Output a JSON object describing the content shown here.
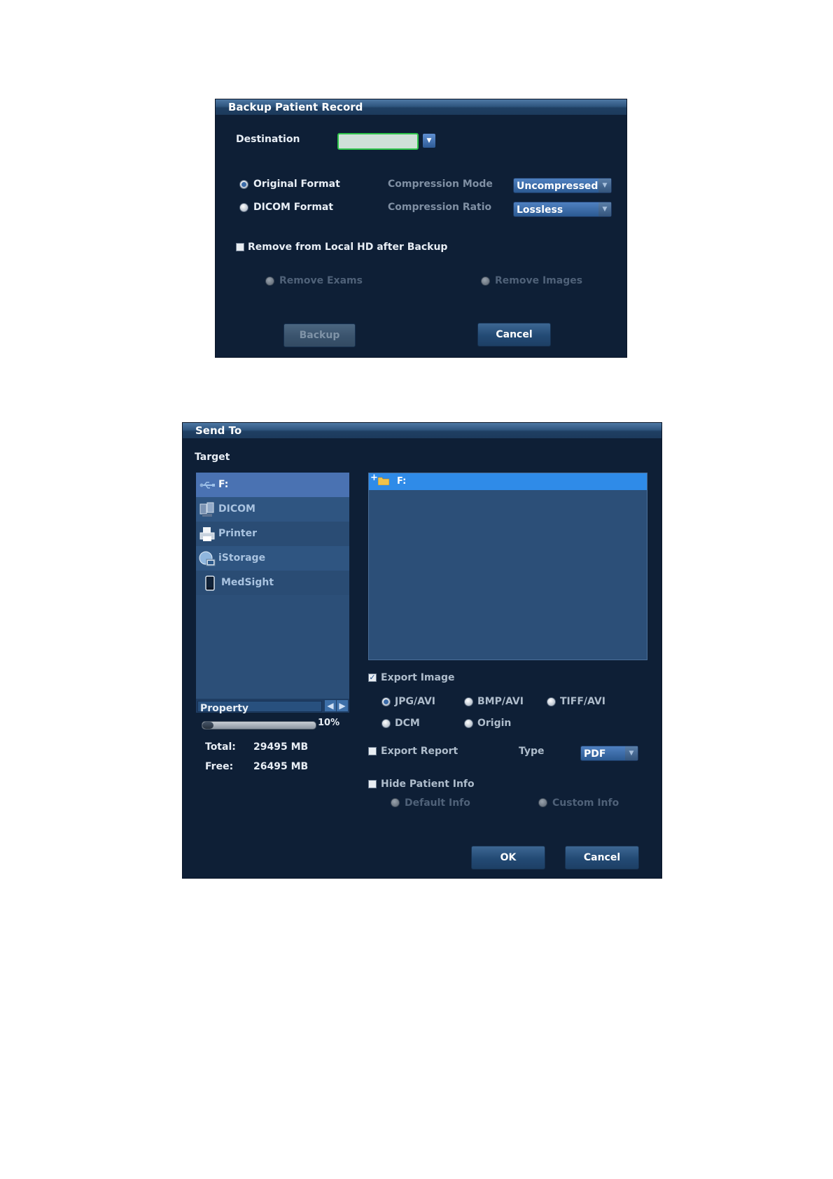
{
  "backup_dialog": {
    "title": "Backup Patient Record",
    "destination_label": "Destination",
    "destination_value": "",
    "original_format": "Original Format",
    "dicom_format": "DICOM Format",
    "compression_mode_label": "Compression Mode",
    "compression_mode_value": "Uncompressed",
    "compression_ratio_label": "Compression Ratio",
    "compression_ratio_value": "Lossless",
    "remove_checkbox": "Remove from Local HD after Backup",
    "remove_exams": "Remove Exams",
    "remove_images": "Remove Images",
    "backup_button": "Backup",
    "cancel_button": "Cancel"
  },
  "send_dialog": {
    "title": "Send To",
    "target_label": "Target",
    "targets": [
      {
        "label": "F:",
        "icon": "usb-icon",
        "selected": true
      },
      {
        "label": "DICOM",
        "icon": "dicom-network-icon"
      },
      {
        "label": "Printer",
        "icon": "printer-icon"
      },
      {
        "label": "iStorage",
        "icon": "istorage-icon"
      },
      {
        "label": "MedSight",
        "icon": "mobile-device-icon"
      }
    ],
    "tree_root": "F:",
    "property_label": "Property",
    "usage_percent": "10%",
    "usage_fraction": 0.1,
    "total_label": "Total:",
    "total_value": "29495 MB",
    "free_label": "Free:",
    "free_value": "26495 MB",
    "export_image": "Export Image",
    "format_jpg": "JPG/AVI",
    "format_bmp": "BMP/AVI",
    "format_tiff": "TIFF/AVI",
    "format_dcm": "DCM",
    "format_origin": "Origin",
    "export_report": "Export Report",
    "type_label": "Type",
    "type_value": "PDF",
    "hide_patient_info": "Hide Patient Info",
    "default_info": "Default Info",
    "custom_info": "Custom Info",
    "ok_button": "OK",
    "cancel_button": "Cancel"
  },
  "colors": {
    "dialog_bg": "#0e1f36",
    "accent_blue": "#2f7fe0",
    "list_bg": "#2c4f78"
  }
}
